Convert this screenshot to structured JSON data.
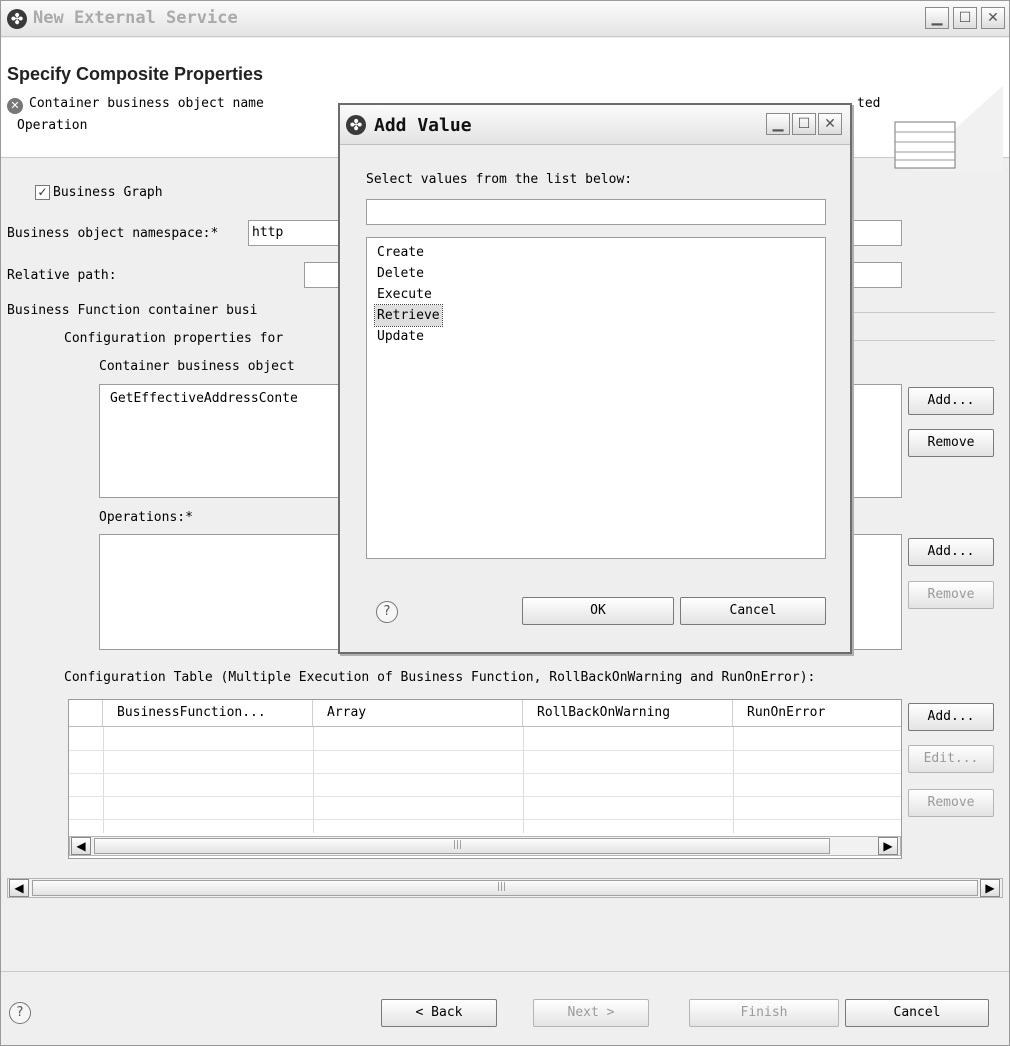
{
  "window": {
    "title": "New External Service",
    "icon": "plug-icon",
    "controls": [
      "minimize-icon",
      "maximize-icon",
      "close-icon"
    ]
  },
  "header": {
    "title": "Specify Composite Properties",
    "message_line1_left": "Container business object name",
    "message_line1_right": "ted",
    "message_line2": "Operation"
  },
  "form": {
    "business_graph": {
      "label": "Business Graph",
      "checked": true
    },
    "namespace_label": "Business object namespace:*",
    "namespace_value": "http",
    "relative_path_label": "Relative path:",
    "relative_path_value": "",
    "bf_container_label": "Business Function container busi",
    "config_props_label": "Configuration properties for",
    "container_bo_label": "Container business object",
    "container_bo_items": [
      "GetEffectiveAddressConte"
    ],
    "container_add": "Add...",
    "container_remove": "Remove",
    "operations_label": "Operations:*",
    "operations_add": "Add...",
    "operations_remove": "Remove"
  },
  "config_table": {
    "label": "Configuration Table (Multiple Execution of Business Function, RollBackOnWarning and RunOnError):",
    "columns": [
      "BusinessFunction...",
      "Array",
      "RollBackOnWarning",
      "RunOnError"
    ],
    "add": "Add...",
    "edit": "Edit...",
    "remove": "Remove"
  },
  "footer": {
    "back": "< Back",
    "next": "Next >",
    "finish": "Finish",
    "cancel": "Cancel"
  },
  "dialog": {
    "title": "Add Value",
    "prompt": "Select values from the list below:",
    "filter_value": "",
    "items": [
      "Create",
      "Delete",
      "Execute",
      "Retrieve",
      "Update"
    ],
    "selected": "Retrieve",
    "ok": "OK",
    "cancel": "Cancel"
  }
}
